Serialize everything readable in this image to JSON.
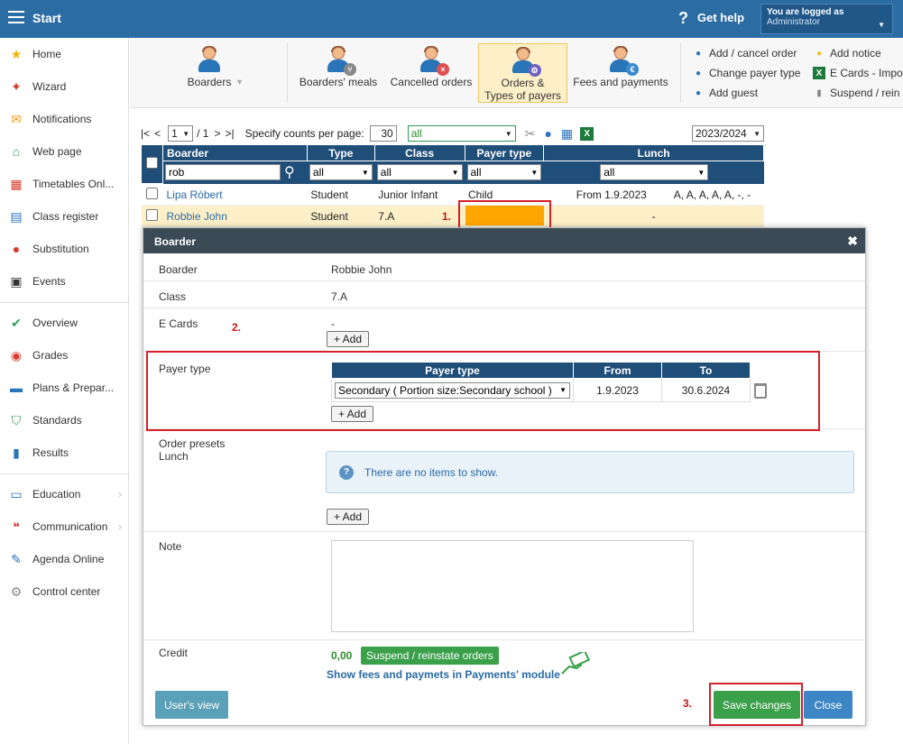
{
  "topbar": {
    "start": "Start",
    "help": "Get help",
    "logged_label": "You are logged as",
    "logged_user": "Administrator"
  },
  "sidebar": {
    "items": [
      {
        "label": "Home",
        "icon": "star-icon",
        "color": "#f0b400"
      },
      {
        "label": "Wizard",
        "icon": "wand-icon",
        "color": "#d63b2f"
      },
      {
        "label": "Notifications",
        "icon": "envelope-icon",
        "color": "#f0a020"
      },
      {
        "label": "Web page",
        "icon": "house-icon",
        "color": "#2e9a58"
      },
      {
        "label": "Timetables Onl...",
        "icon": "calendar-grid-icon",
        "color": "#d63b2f"
      },
      {
        "label": "Class register",
        "icon": "register-book-icon",
        "color": "#2a74b8"
      },
      {
        "label": "Substitution",
        "icon": "person-icon",
        "color": "#d63b2f"
      },
      {
        "label": "Events",
        "icon": "calendar-icon",
        "color": "#333333"
      },
      {
        "label": "Overview",
        "icon": "check-circle-icon",
        "color": "#2e9a58"
      },
      {
        "label": "Grades",
        "icon": "grades-icon",
        "color": "#d63b2f"
      },
      {
        "label": "Plans & Prepar...",
        "icon": "briefcase-icon",
        "color": "#2a74b8"
      },
      {
        "label": "Standards",
        "icon": "shield-check-icon",
        "color": "#2e9a58"
      },
      {
        "label": "Results",
        "icon": "bar-chart-icon",
        "color": "#2a74b8"
      },
      {
        "label": "Education",
        "icon": "book-open-icon",
        "color": "#2a74b8"
      },
      {
        "label": "Communication",
        "icon": "chat-bubbles-icon",
        "color": "#d63b2f"
      },
      {
        "label": "Agenda Online",
        "icon": "pen-icon",
        "color": "#2a74b8"
      },
      {
        "label": "Control center",
        "icon": "gear-icon",
        "color": "#888888"
      }
    ]
  },
  "ribbon": {
    "boarders": "Boarders",
    "meals": "Boarders' meals",
    "cancelled": "Cancelled orders",
    "orders_line1": "Orders &",
    "orders_line2": "Types of payers",
    "fees": "Fees and payments",
    "links": {
      "add_cancel": "Add / cancel order",
      "change_payer": "Change payer type",
      "add_guest": "Add guest",
      "add_notice": "Add notice",
      "ecards": "E Cards - Impo",
      "suspend": "Suspend / rein"
    }
  },
  "pager": {
    "first": "|<",
    "prev": "<",
    "page": "1",
    "of": "/ 1",
    "next": ">",
    "last": ">|",
    "counts_label": "Specify counts per page:",
    "counts_value": "30",
    "filter_value": "all",
    "year": "2023/2024"
  },
  "grid": {
    "headers": {
      "boarder": "Boarder",
      "type": "Type",
      "class": "Class",
      "payer": "Payer type",
      "lunch": "Lunch"
    },
    "filters": {
      "search": "rob",
      "type": "all",
      "class": "all",
      "payer": "all",
      "lunch": "all"
    },
    "rows": [
      {
        "name": "Lipa Róbert",
        "type": "Student",
        "class": "Junior Infant",
        "payer": "Child",
        "lunch_from": "From 1.9.2023",
        "lunch_days": "A, A, A, A, A, -, -"
      },
      {
        "name": "Robbie John",
        "type": "Student",
        "class": "7.A",
        "payer": "",
        "lunch_from": "-",
        "lunch_days": ""
      }
    ]
  },
  "annotations": {
    "a1": "1.",
    "a2": "2.",
    "a3": "3."
  },
  "modal": {
    "title": "Boarder",
    "boarder_label": "Boarder",
    "boarder_value": "Robbie John",
    "class_label": "Class",
    "class_value": "7.A",
    "ecards_label": "E Cards",
    "ecards_value": "-",
    "add": "+ Add",
    "payer_label": "Payer type",
    "payer_headers": {
      "type": "Payer type",
      "from": "From",
      "to": "To"
    },
    "payer_row": {
      "type": "Secondary ( Portion size:Secondary school )",
      "from": "1.9.2023",
      "to": "30.6.2024"
    },
    "presets_label1": "Order presets",
    "presets_label2": "Lunch",
    "no_items": "There are no items to show.",
    "note_label": "Note",
    "credit_label": "Credit",
    "credit_value": "0,00",
    "suspend": "Suspend / reinstate orders",
    "show_fees": "Show fees and paymets in Payments' module",
    "user_view": "User's view",
    "save": "Save changes",
    "close": "Close"
  }
}
